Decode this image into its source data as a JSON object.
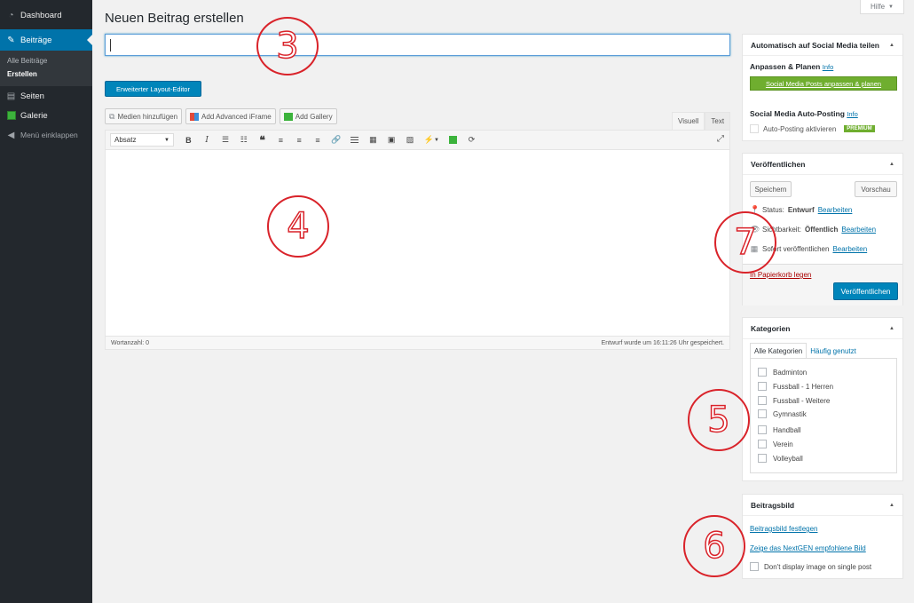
{
  "sidebar": {
    "dashboard": "Dashboard",
    "beitraege": "Beiträge",
    "sub_alle": "Alle Beiträge",
    "sub_erstellen": "Erstellen",
    "seiten": "Seiten",
    "galerie": "Galerie",
    "collapse": "Menü einklappen"
  },
  "help": {
    "label": "Hilfe",
    "arrow": "▼"
  },
  "page_title": "Neuen Beitrag erstellen",
  "layout_button": "Erweiterter Layout-Editor",
  "media_buttons": {
    "media": "Medien hinzufügen",
    "iframe": "Add Advanced iFrame",
    "gallery": "Add Gallery"
  },
  "editor": {
    "tab_visual": "Visuell",
    "tab_text": "Text",
    "format_select": "Absatz",
    "word_count": "Wortanzahl: 0",
    "saved": "Entwurf wurde um 16:11:26 Uhr gespeichert."
  },
  "social_box": {
    "title": "Automatisch auf Social Media teilen",
    "anpassen": "Anpassen & Planen",
    "info1": "Info",
    "button": "Social Media Posts anpassen & planen",
    "auto_title": "Social Media Auto-Posting",
    "info2": "Info",
    "auto_label": "Auto-Posting aktivieren",
    "premium": "PREMIUM"
  },
  "publish_box": {
    "title": "Veröffentlichen",
    "save": "Speichern",
    "preview": "Vorschau",
    "status_label": "Status:",
    "status_value": "Entwurf",
    "edit1": "Bearbeiten",
    "visibility_label": "Sichtbarkeit:",
    "visibility_value": "Öffentlich",
    "edit2": "Bearbeiten",
    "schedule_label": "Sofort veröffentlichen",
    "edit3": "Bearbeiten",
    "trash": "In Papierkorb legen",
    "publish": "Veröffentlichen"
  },
  "categories_box": {
    "title": "Kategorien",
    "tab_all": "Alle Kategorien",
    "tab_used": "Häufig genutzt",
    "items": [
      "Badminton",
      "Fussball - 1 Herren",
      "Fussball - Weitere",
      "Gymnastik",
      "Handball",
      "Verein",
      "Volleyball"
    ]
  },
  "image_box": {
    "title": "Beitragsbild",
    "set_link": "Beitragsbild festlegen",
    "nextgen_link": "Zeige das NextGEN empfohlene Bild",
    "dont_display": "Don't display image on single post"
  },
  "annotations": [
    "3",
    "4",
    "5",
    "6",
    "7"
  ],
  "colors": {
    "sidebar_bg": "#23282d",
    "accent": "#0073aa",
    "annotation_red": "#d9232a",
    "green": "#6fae2f"
  }
}
